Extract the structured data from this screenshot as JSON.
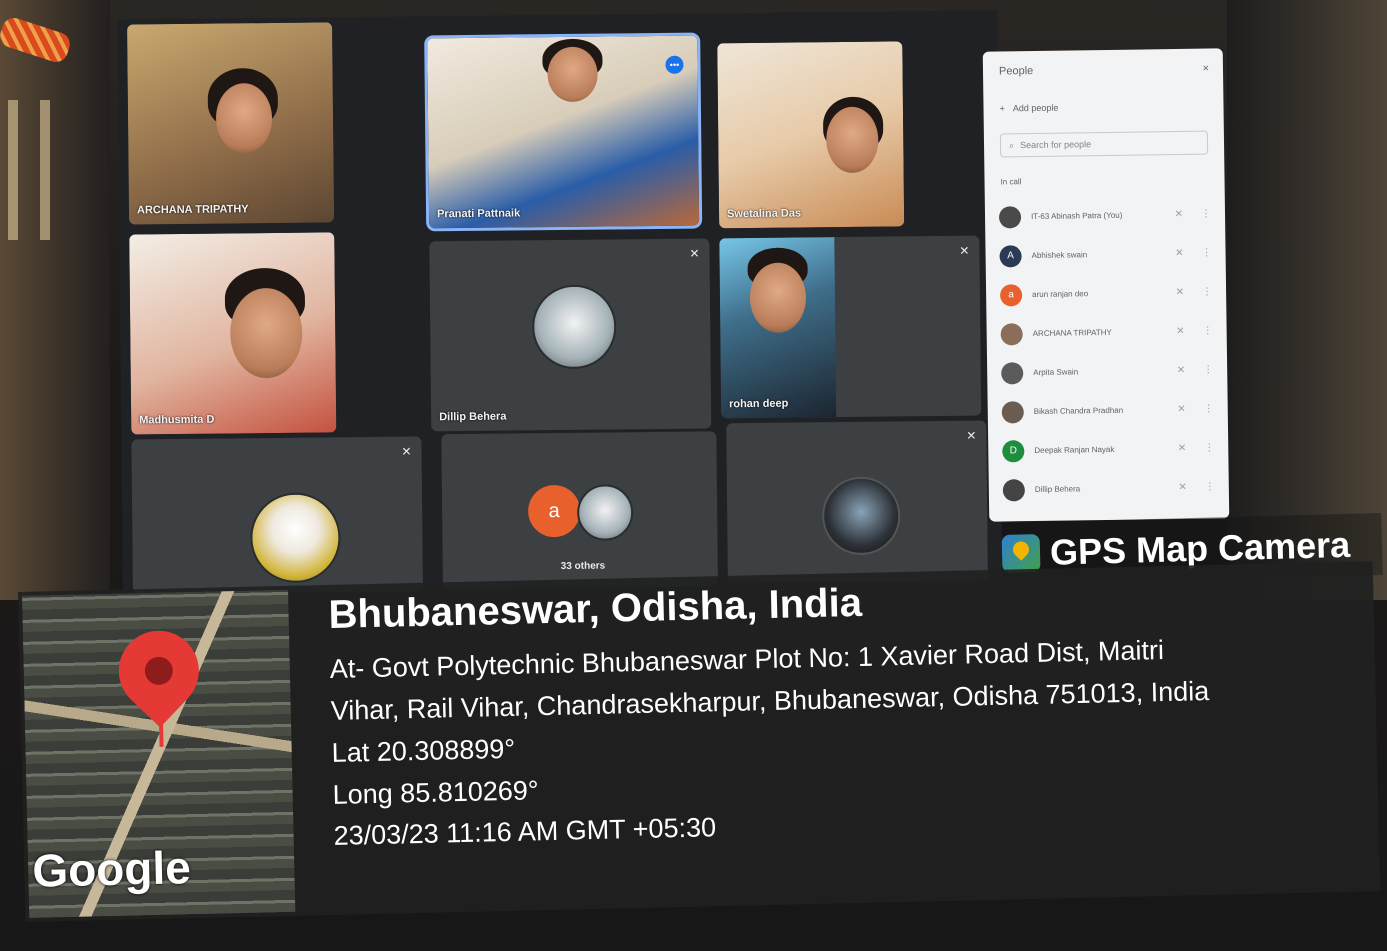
{
  "meeting": {
    "participants": [
      {
        "name": "ARCHANA TRIPATHY"
      },
      {
        "name": "Pranati Pattnaik"
      },
      {
        "name": "Swetalina Das"
      },
      {
        "name": "Madhusmita D"
      },
      {
        "name": "Dillip Behera"
      },
      {
        "name": "rohan deep"
      }
    ],
    "others_avatar_letter": "a",
    "others_label": "33 others"
  },
  "people_panel": {
    "title": "People",
    "close_icon": "×",
    "add_people_label": "Add people",
    "search_placeholder": "Search for people",
    "section_label": "In call",
    "list": [
      {
        "name": "IT-63 Abinash Patra (You)",
        "avatar": ""
      },
      {
        "name": "Abhishek swain",
        "avatar": "A"
      },
      {
        "name": "arun ranjan deo",
        "avatar": "a"
      },
      {
        "name": "ARCHANA TRIPATHY",
        "avatar": ""
      },
      {
        "name": "Arpita Swain",
        "avatar": ""
      },
      {
        "name": "Bikash Chandra Pradhan",
        "avatar": ""
      },
      {
        "name": "Deepak Ranjan Nayak",
        "avatar": "D"
      },
      {
        "name": "Dillip Behera",
        "avatar": ""
      }
    ]
  },
  "gps": {
    "badge_label": "GPS Map Camera",
    "map_brand": "Google",
    "city": "Bhubaneswar, Odisha, India",
    "address_line1": "At- Govt Polytechnic Bhubaneswar Plot No: 1 Xavier Road Dist, Maitri",
    "address_line2": "Vihar, Rail Vihar, Chandrasekharpur, Bhubaneswar, Odisha 751013, India",
    "lat": "Lat 20.308899°",
    "long": "Long 85.810269°",
    "timestamp": "23/03/23 11:16 AM GMT +05:30"
  },
  "icons": {
    "mic": "mic-off-icon",
    "pin": "location-pin-icon",
    "search": "search-icon"
  }
}
